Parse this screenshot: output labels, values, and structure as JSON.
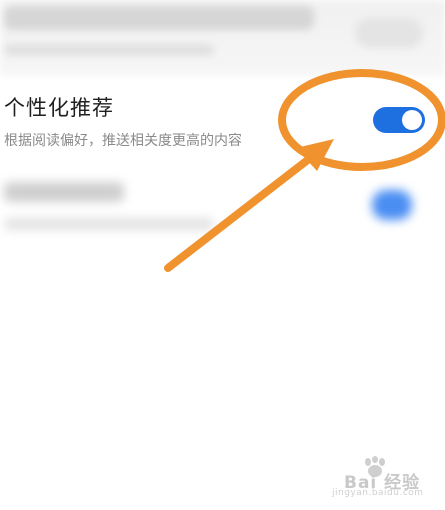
{
  "setting": {
    "title": "个性化推荐",
    "description": "根据阅读偏好，推送相关度更高的内容",
    "toggle_on": true
  },
  "colors": {
    "toggle_active": "#1e6fe0",
    "annotation": "#f0922e"
  },
  "watermark": {
    "brand": "Bai 经验",
    "url": "jingyan.baidu.com"
  }
}
